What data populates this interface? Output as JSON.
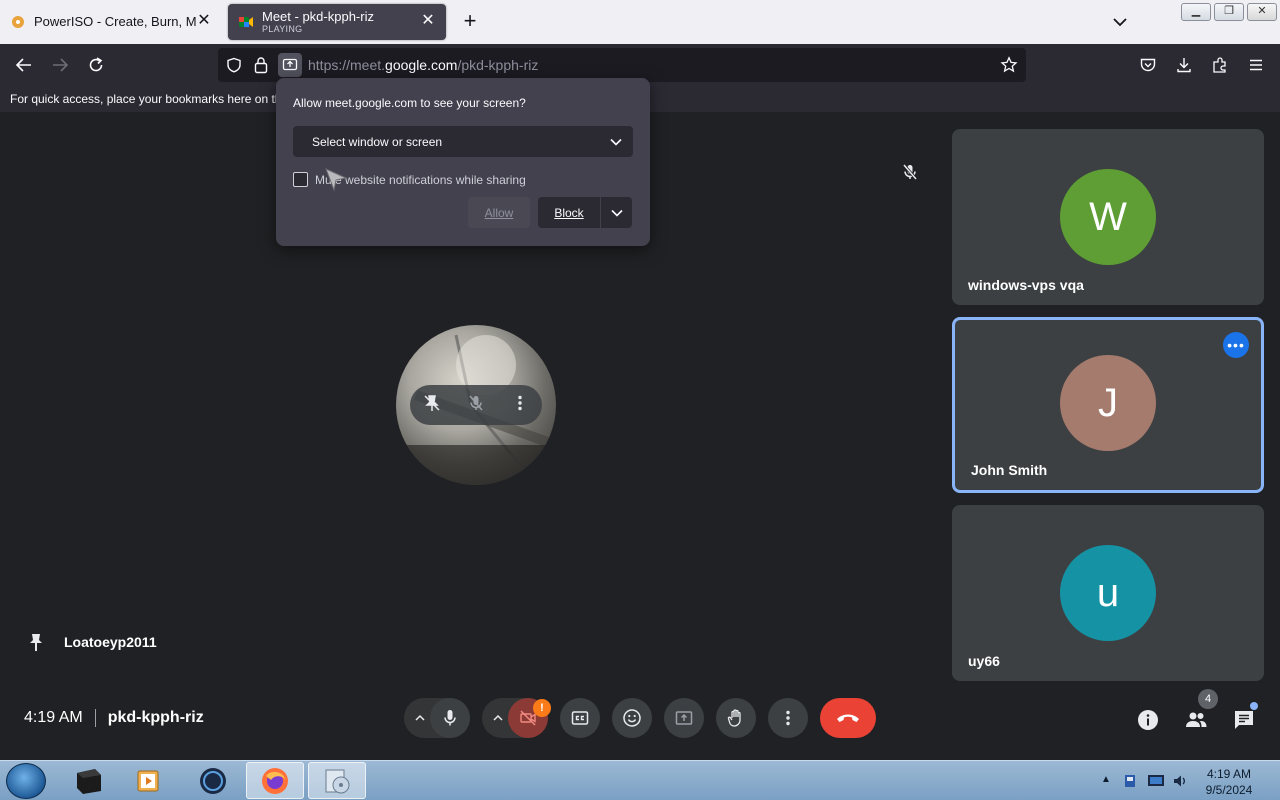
{
  "browser": {
    "tabs": [
      {
        "title": "PowerISO - Create, Burn, Moun",
        "status": "",
        "active": false
      },
      {
        "title": "Meet - pkd-kpph-riz",
        "status": "PLAYING",
        "active": true
      }
    ],
    "url": {
      "prefix": "https://meet.",
      "host": "google.com",
      "path": "/pkd-kpph-riz"
    },
    "bookmarks_hint": "For quick access, place your bookmarks here on th"
  },
  "permission_popup": {
    "title": "Allow meet.google.com to see your screen?",
    "select_value": "Select window or screen",
    "checkbox_label": "Mute website notifications while sharing",
    "checkbox_checked": false,
    "allow_label": "Allow",
    "block_label": "Block"
  },
  "meet": {
    "pinned_name": "Loatoeyp2011",
    "time": "4:19 AM",
    "meeting_code": "pkd-kpph-riz",
    "people_count": "4",
    "camera_alert": "!",
    "participants": [
      {
        "initial": "W",
        "name": "windows-vps vqa",
        "color": "#5e9e34"
      },
      {
        "initial": "J",
        "name": "John Smith",
        "color": "#a57b6d"
      },
      {
        "initial": "u",
        "name": "uy66",
        "color": "#1592a3"
      }
    ]
  },
  "taskbar": {
    "time": "4:19 AM",
    "date": "9/5/2024"
  },
  "colors": {
    "hangup": "#ea4335",
    "focus_border": "#8ab4f8",
    "meet_bg": "#202124"
  }
}
